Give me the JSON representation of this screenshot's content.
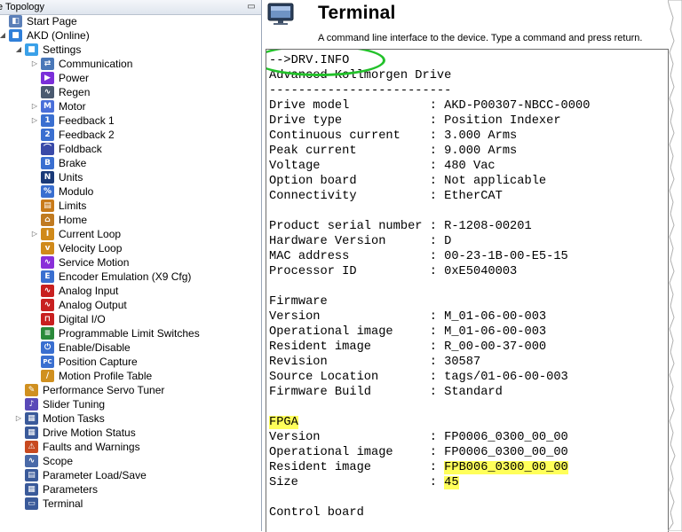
{
  "topology": {
    "header": "e Topology",
    "pin_icon": "pin-icon",
    "items": [
      {
        "label": "Start Page",
        "icon": "start-page-icon",
        "glyph": "◧",
        "color": "#5b7fb8",
        "level": 0,
        "expand": ""
      },
      {
        "label": "AKD (Online)",
        "icon": "drive-cube-icon",
        "glyph": "■",
        "color": "#2f7fd9",
        "level": 0,
        "expand": "◢"
      },
      {
        "label": "Settings",
        "icon": "settings-cube-icon",
        "glyph": "■",
        "color": "#3aa0e8",
        "level": 1,
        "expand": "◢"
      },
      {
        "label": "Communication",
        "icon": "communication-icon",
        "glyph": "⇄",
        "color": "#4a78b8",
        "level": 2,
        "expand": "▷"
      },
      {
        "label": "Power",
        "icon": "power-arrow-icon",
        "glyph": "▶",
        "color": "#7b2fd9",
        "level": 2,
        "expand": ""
      },
      {
        "label": "Regen",
        "icon": "regen-wave-icon",
        "glyph": "∿",
        "color": "#4a5a70",
        "level": 2,
        "expand": ""
      },
      {
        "label": "Motor",
        "icon": "motor-icon",
        "glyph": "M",
        "color": "#4a6fd9",
        "level": 2,
        "expand": "▷"
      },
      {
        "label": "Feedback 1",
        "icon": "feedback1-icon",
        "glyph": "1",
        "color": "#3a6fd0",
        "level": 2,
        "expand": "▷"
      },
      {
        "label": "Feedback 2",
        "icon": "feedback2-icon",
        "glyph": "2",
        "color": "#3a6fd0",
        "level": 2,
        "expand": ""
      },
      {
        "label": "Foldback",
        "icon": "foldback-icon",
        "glyph": "⌒",
        "color": "#3a4aa8",
        "level": 2,
        "expand": ""
      },
      {
        "label": "Brake",
        "icon": "brake-icon",
        "glyph": "B",
        "color": "#3a6fd0",
        "level": 2,
        "expand": ""
      },
      {
        "label": "Units",
        "icon": "units-icon",
        "glyph": "N",
        "color": "#1a3a78",
        "level": 2,
        "expand": ""
      },
      {
        "label": "Modulo",
        "icon": "modulo-icon",
        "glyph": "%",
        "color": "#3a6fd0",
        "level": 2,
        "expand": ""
      },
      {
        "label": "Limits",
        "icon": "limits-icon",
        "glyph": "▤",
        "color": "#c87a1a",
        "level": 2,
        "expand": ""
      },
      {
        "label": "Home",
        "icon": "home-icon",
        "glyph": "⌂",
        "color": "#c07a20",
        "level": 2,
        "expand": ""
      },
      {
        "label": "Current Loop",
        "icon": "current-loop-icon",
        "glyph": "I",
        "color": "#d08a1a",
        "level": 2,
        "expand": "▷"
      },
      {
        "label": "Velocity Loop",
        "icon": "velocity-loop-icon",
        "glyph": "v",
        "color": "#d08a1a",
        "level": 2,
        "expand": ""
      },
      {
        "label": "Service Motion",
        "icon": "service-motion-icon",
        "glyph": "∿",
        "color": "#8a2fd9",
        "level": 2,
        "expand": ""
      },
      {
        "label": "Encoder Emulation (X9 Cfg)",
        "icon": "encoder-emulation-icon",
        "glyph": "E",
        "color": "#3a6fd0",
        "level": 2,
        "expand": ""
      },
      {
        "label": "Analog Input",
        "icon": "analog-input-icon",
        "glyph": "∿",
        "color": "#c82020",
        "level": 2,
        "expand": ""
      },
      {
        "label": "Analog Output",
        "icon": "analog-output-icon",
        "glyph": "∿",
        "color": "#c82020",
        "level": 2,
        "expand": ""
      },
      {
        "label": "Digital I/O",
        "icon": "digital-io-icon",
        "glyph": "⊓",
        "color": "#c82020",
        "level": 2,
        "expand": ""
      },
      {
        "label": "Programmable Limit Switches",
        "icon": "limit-switches-icon",
        "glyph": "≡",
        "color": "#2a8a3a",
        "level": 2,
        "expand": ""
      },
      {
        "label": "Enable/Disable",
        "icon": "enable-disable-icon",
        "glyph": "⏻",
        "color": "#3a6fd0",
        "level": 2,
        "expand": ""
      },
      {
        "label": "Position Capture",
        "icon": "position-capture-icon",
        "glyph": "PC",
        "color": "#3a6fd0",
        "level": 2,
        "expand": ""
      },
      {
        "label": "Motion Profile Table",
        "icon": "motion-profile-icon",
        "glyph": "∕",
        "color": "#d09020",
        "level": 2,
        "expand": ""
      },
      {
        "label": "Performance Servo Tuner",
        "icon": "servo-tuner-icon",
        "glyph": "✎",
        "color": "#d09020",
        "level": 1,
        "expand": ""
      },
      {
        "label": "Slider Tuning",
        "icon": "slider-tuning-icon",
        "glyph": "♪",
        "color": "#5a4ab8",
        "level": 1,
        "expand": ""
      },
      {
        "label": "Motion Tasks",
        "icon": "motion-tasks-icon",
        "glyph": "▦",
        "color": "#3a5a9a",
        "level": 1,
        "expand": "▷"
      },
      {
        "label": "Drive Motion Status",
        "icon": "motion-status-icon",
        "glyph": "▦",
        "color": "#3a5a9a",
        "level": 1,
        "expand": ""
      },
      {
        "label": "Faults and Warnings",
        "icon": "faults-warnings-icon",
        "glyph": "⚠",
        "color": "#c84a20",
        "level": 1,
        "expand": ""
      },
      {
        "label": "Scope",
        "icon": "scope-icon",
        "glyph": "∿",
        "color": "#4a6aa8",
        "level": 1,
        "expand": ""
      },
      {
        "label": "Parameter Load/Save",
        "icon": "parameter-load-save-icon",
        "glyph": "▤",
        "color": "#3a5a9a",
        "level": 1,
        "expand": ""
      },
      {
        "label": "Parameters",
        "icon": "parameters-icon",
        "glyph": "▦",
        "color": "#3a5a9a",
        "level": 1,
        "expand": ""
      },
      {
        "label": "Terminal",
        "icon": "terminal-icon",
        "glyph": "▭",
        "color": "#3a5a9a",
        "level": 1,
        "expand": ""
      }
    ]
  },
  "terminal": {
    "title": "Terminal",
    "description": "A command line interface to the device. Type a command and press return.",
    "header_icon": "computer-monitor-icon",
    "lines": [
      {
        "text": "-->DRV.INFO",
        "hl": ""
      },
      {
        "text": "Advanced Kollmorgen Drive",
        "hl": ""
      },
      {
        "text": "-------------------------",
        "hl": ""
      },
      {
        "text": "Drive model           : AKD-P00307-NBCC-0000",
        "hl": ""
      },
      {
        "text": "Drive type            : Position Indexer",
        "hl": ""
      },
      {
        "text": "Continuous current    : 3.000 Arms",
        "hl": ""
      },
      {
        "text": "Peak current          : 9.000 Arms",
        "hl": ""
      },
      {
        "text": "Voltage               : 480 Vac",
        "hl": ""
      },
      {
        "text": "Option board          : Not applicable",
        "hl": ""
      },
      {
        "text": "Connectivity          : EtherCAT",
        "hl": ""
      },
      {
        "text": "",
        "hl": ""
      },
      {
        "text": "Product serial number : R-1208-00201",
        "hl": ""
      },
      {
        "text": "Hardware Version      : D",
        "hl": ""
      },
      {
        "text": "MAC address           : 00-23-1B-00-E5-15",
        "hl": ""
      },
      {
        "text": "Processor ID          : 0xE5040003",
        "hl": ""
      },
      {
        "text": "",
        "hl": ""
      },
      {
        "text": "Firmware",
        "hl": ""
      },
      {
        "text": "Version               : M_01-06-00-003",
        "hl": ""
      },
      {
        "text": "Operational image     : M_01-06-00-003",
        "hl": ""
      },
      {
        "text": "Resident image        : R_00-00-37-000",
        "hl": ""
      },
      {
        "text": "Revision              : 30587",
        "hl": ""
      },
      {
        "text": "Source Location       : tags/01-06-00-003",
        "hl": ""
      },
      {
        "text": "Firmware Build        : Standard",
        "hl": ""
      },
      {
        "text": "",
        "hl": ""
      },
      {
        "text": "FPGA",
        "hl": "label"
      },
      {
        "text": "Version               : FP0006_0300_00_00",
        "hl": ""
      },
      {
        "text": "Operational image     : FP0006_0300_00_00",
        "hl": ""
      },
      {
        "text": "Resident image        : FPB006_0300_00_00",
        "hl": "value"
      },
      {
        "text": "Size                  : 45",
        "hl": "value"
      },
      {
        "text": "",
        "hl": ""
      },
      {
        "text": "Control board",
        "hl": ""
      }
    ]
  },
  "colors": {
    "highlight": "#ffff5a",
    "annotation_circle": "#22c12a"
  }
}
